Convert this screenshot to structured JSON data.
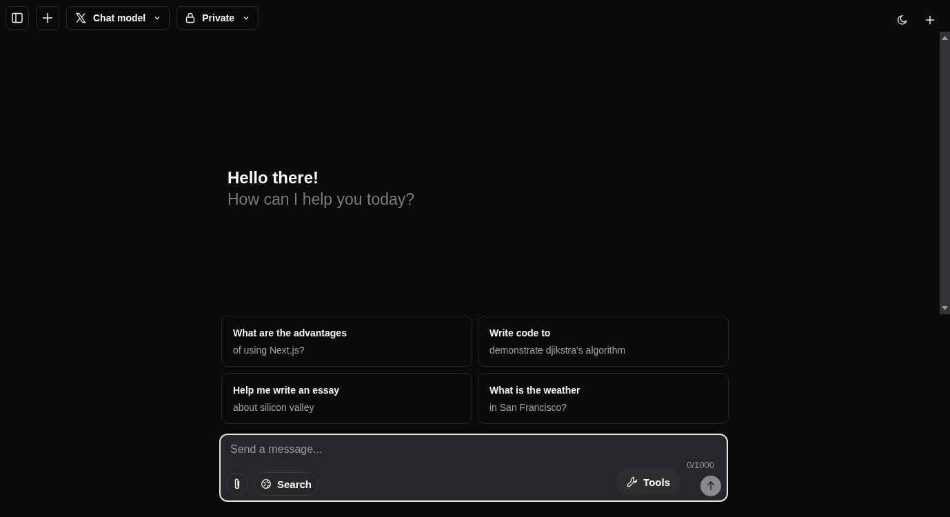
{
  "header": {
    "model": "Chat model",
    "visibility": "Private"
  },
  "greeting": {
    "title": "Hello there!",
    "subtitle": "How can I help you today?"
  },
  "suggestions": [
    {
      "title": "What are the advantages",
      "detail": "of using Next.js?"
    },
    {
      "title": "Write code to",
      "detail": "demonstrate djikstra's algorithm"
    },
    {
      "title": "Help me write an essay",
      "detail": "about silicon valley"
    },
    {
      "title": "What is the weather",
      "detail": "in San Francisco?"
    }
  ],
  "composer": {
    "placeholder": "Send a message...",
    "counter": "0/1000",
    "search_label": "Search",
    "tools_label": "Tools",
    "send_disabled": true
  }
}
